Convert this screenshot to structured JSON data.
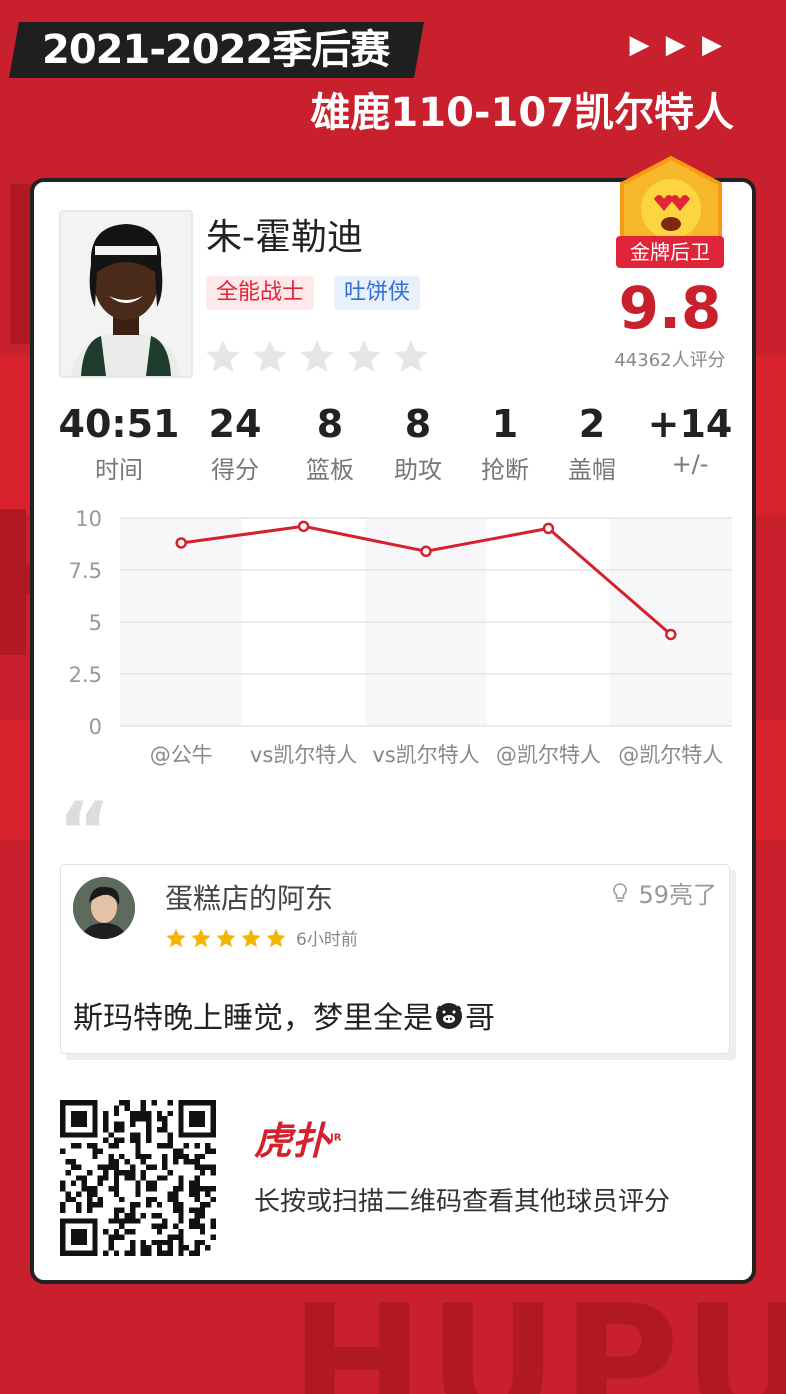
{
  "header": {
    "season": "2021-2022季后赛",
    "score_title": "雄鹿110-107凯尔特人",
    "arrows": "▶ ▶ ▶"
  },
  "player": {
    "name": "朱-霍勒迪",
    "tags": [
      "全能战士",
      "吐饼侠"
    ],
    "badge": "金牌后卫",
    "rating": "9.8",
    "rating_count": "44362人评分"
  },
  "stats": [
    {
      "value": "40:51",
      "label": "时间"
    },
    {
      "value": "24",
      "label": "得分"
    },
    {
      "value": "8",
      "label": "篮板"
    },
    {
      "value": "8",
      "label": "助攻"
    },
    {
      "value": "1",
      "label": "抢断"
    },
    {
      "value": "2",
      "label": "盖帽"
    },
    {
      "value": "+14",
      "label": "+/-"
    }
  ],
  "chart_data": {
    "type": "line",
    "categories": [
      "@公牛",
      "vs凯尔特人",
      "vs凯尔特人",
      "@凯尔特人",
      "@凯尔特人"
    ],
    "values": [
      8.8,
      9.6,
      8.4,
      9.5,
      4.4
    ],
    "y_ticks": [
      "10",
      "7.5",
      "5",
      "2.5",
      "0"
    ],
    "ylim": [
      0,
      10
    ],
    "line_color": "#d4212e",
    "grid": true
  },
  "comment": {
    "user": "蛋糕店的阿东",
    "time": "6小时前",
    "likes": "59亮了",
    "stars": 5,
    "text_before": "斯玛特晚上睡觉，梦里全是",
    "text_after": "哥"
  },
  "footer": {
    "brand": "虎扑",
    "brand_sup": "JR",
    "hint": "长按或扫描二维码查看其他球员评分"
  },
  "colors": {
    "accent": "#c8202c",
    "star_gold": "#f4b400"
  }
}
